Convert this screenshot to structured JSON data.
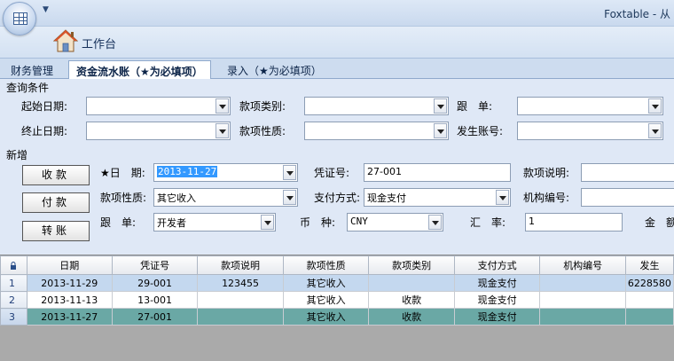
{
  "app": {
    "title": "Foxtable - 从"
  },
  "ribbon": {
    "workbench_label": "工作台"
  },
  "tabs": [
    {
      "label": "财务管理",
      "active": false
    },
    {
      "label": "资金流水账（★为必填项）",
      "active": true
    },
    {
      "label": "录入（★为必填项）",
      "active": false
    }
  ],
  "query": {
    "title": "查询条件",
    "start_date_label": "起始日期:",
    "end_date_label": "终止日期:",
    "category_label": "款项类别:",
    "nature_label": "款项性质:",
    "follower_label": "跟　单:",
    "account_label": "发生账号:"
  },
  "add": {
    "title": "新增",
    "buttons": {
      "receive": "收款",
      "pay": "付款",
      "transfer": "转账"
    },
    "date_label": "★日　期:",
    "date_value": "2013-11-27",
    "voucher_label": "凭证号:",
    "voucher_value": "27-001",
    "desc_label": "款项说明:",
    "nature_label": "款项性质:",
    "nature_value": "其它收入",
    "paymethod_label": "支付方式:",
    "paymethod_value": "现金支付",
    "org_label": "机构编号:",
    "follower_label": "跟　单:",
    "follower_value": "开发者",
    "currency_label": "币　种:",
    "currency_value": "CNY",
    "rate_label": "汇　率:",
    "rate_value": "1",
    "amount_label": "金　额"
  },
  "grid": {
    "columns": [
      "日期",
      "凭证号",
      "款项说明",
      "款项性质",
      "款项类别",
      "支付方式",
      "机构编号",
      "发生"
    ],
    "rows": [
      {
        "num": "1",
        "cells": [
          "2013-11-29",
          "29-001",
          "123455",
          "其它收入",
          "",
          "现金支付",
          "",
          "6228580"
        ]
      },
      {
        "num": "2",
        "cells": [
          "2013-11-13",
          "13-001",
          "",
          "其它收入",
          "收款",
          "现金支付",
          "",
          ""
        ]
      },
      {
        "num": "3",
        "cells": [
          "2013-11-27",
          "27-001",
          "",
          "其它收入",
          "收款",
          "现金支付",
          "",
          ""
        ]
      }
    ]
  },
  "colors": {
    "selected_row": "#6aa8a5",
    "first_row": "#c4d8ef",
    "ribbon": "#dfe8f6"
  }
}
